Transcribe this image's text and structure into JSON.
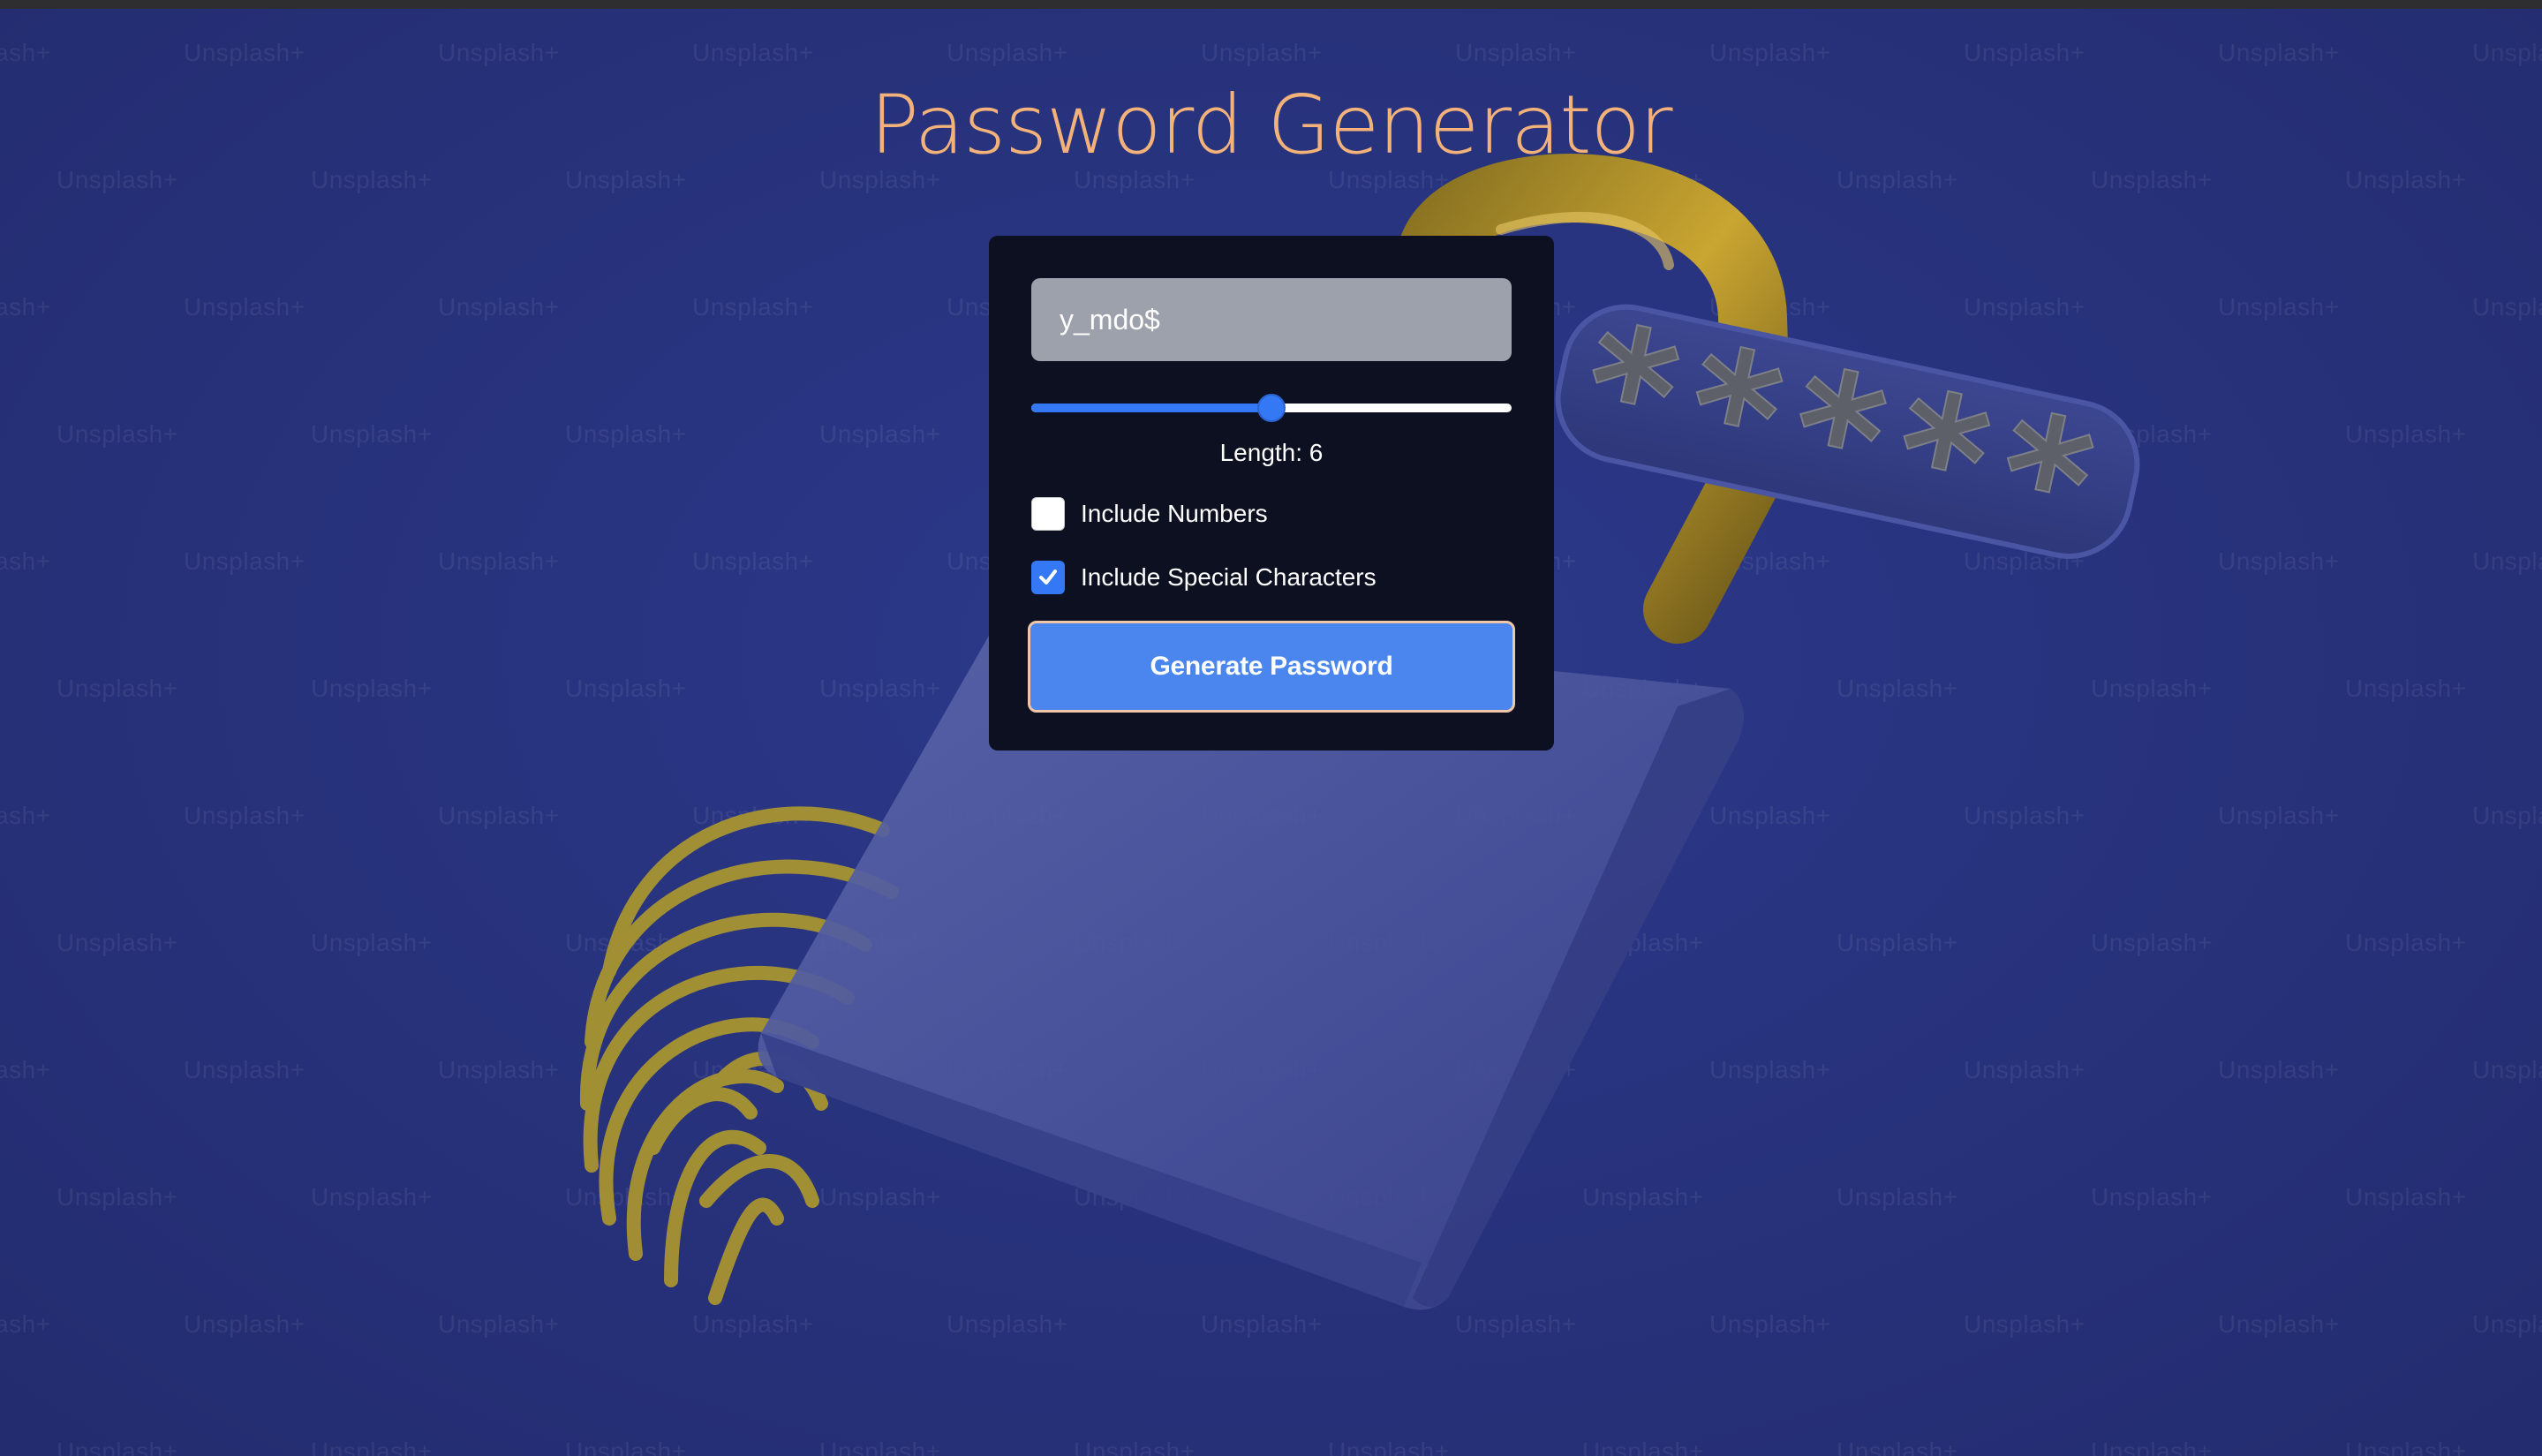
{
  "page": {
    "title": "Password Generator",
    "background_color": "#28337e",
    "watermark_text": "Unsplash+"
  },
  "generator": {
    "password_value": "y_mdo$",
    "length_label": "Length: 6",
    "length_fraction": 0.5,
    "options": [
      {
        "label": "Include Numbers",
        "checked": false
      },
      {
        "label": "Include Special Characters",
        "checked": true
      }
    ],
    "generate_button_label": "Generate Password"
  },
  "colors": {
    "title": "#f2b27a",
    "panel": "#0c1020",
    "accent": "#3478f6",
    "button": "#4a86ee",
    "button_border": "#f0c6a8",
    "lock_gold": "#b8962a"
  },
  "illustration": {
    "icons": [
      "padlock-icon",
      "fingerprint-icon",
      "password-asterisks-bar"
    ],
    "asterisks": "******"
  }
}
